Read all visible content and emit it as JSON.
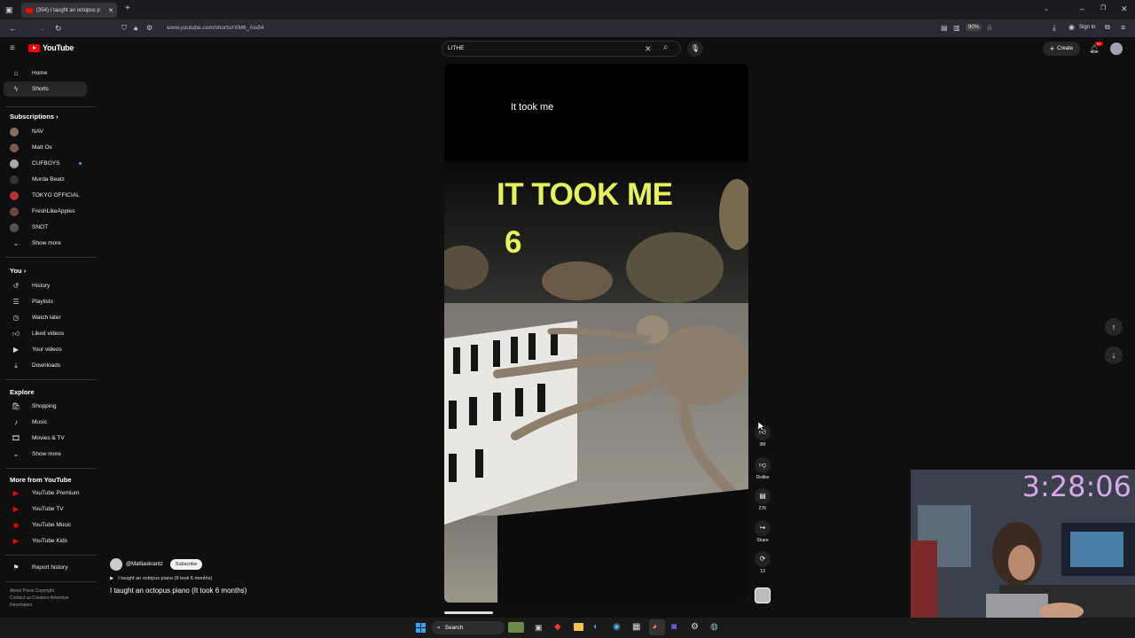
{
  "browser": {
    "tab_title": "(354) I taught an octopus p",
    "url": "www.youtube.com/shorts/rXM6_Ais84",
    "zoom": "90%",
    "sign_in": "Sign in"
  },
  "youtube": {
    "logo": "YouTube",
    "search_value": "LITHE",
    "create_label": "Create",
    "notif_badge": "9+"
  },
  "sidebar": {
    "home": "Home",
    "shorts": "Shorts",
    "subscriptions": "Subscriptions",
    "subs": [
      {
        "name": "NAV",
        "color": "#8a6d5c"
      },
      {
        "name": "Matt Ox",
        "color": "#7a5a48"
      },
      {
        "name": "CUFBOYS",
        "color": "#aaaaaa"
      },
      {
        "name": "Murda Beatz",
        "color": "#333333"
      },
      {
        "name": "TOKYO OFFICIAL",
        "color": "#b33"
      },
      {
        "name": "FreshLikeApples",
        "color": "#6a4a3a"
      },
      {
        "name": "SNOT",
        "color": "#555"
      }
    ],
    "show_more": "Show more",
    "you": "You",
    "you_items": [
      "History",
      "Playlists",
      "Watch later",
      "Liked videos",
      "Your videos",
      "Downloads"
    ],
    "explore": "Explore",
    "explore_items": [
      "Shopping",
      "Music",
      "Movies & TV"
    ],
    "show_more_2": "Show more",
    "more_from": "More from YouTube",
    "more_items": [
      "YouTube Premium",
      "YouTube TV",
      "YouTube Music",
      "YouTube Kids"
    ],
    "report": "Report history",
    "footer_1": "About  Press  Copyright",
    "footer_2": "Contact us  Creators  Advertise",
    "footer_3": "Developers"
  },
  "short": {
    "caption_top": "It took me",
    "overlay_line1": "IT TOOK ME",
    "overlay_line2": "6",
    "channel": "@Mattiaskrantz",
    "subscribe": "Subscribe",
    "playlist_line": "I taught an octopus piano (It took 6 months)",
    "title": "I taught an octopus piano (It took 6 months)"
  },
  "controls": {
    "likes": "3M",
    "dislike": "Dislike",
    "comments": "27K",
    "share": "Share",
    "remix": "13"
  },
  "stream": {
    "timer": "3:28:06"
  },
  "taskbar": {
    "search": "Search"
  }
}
